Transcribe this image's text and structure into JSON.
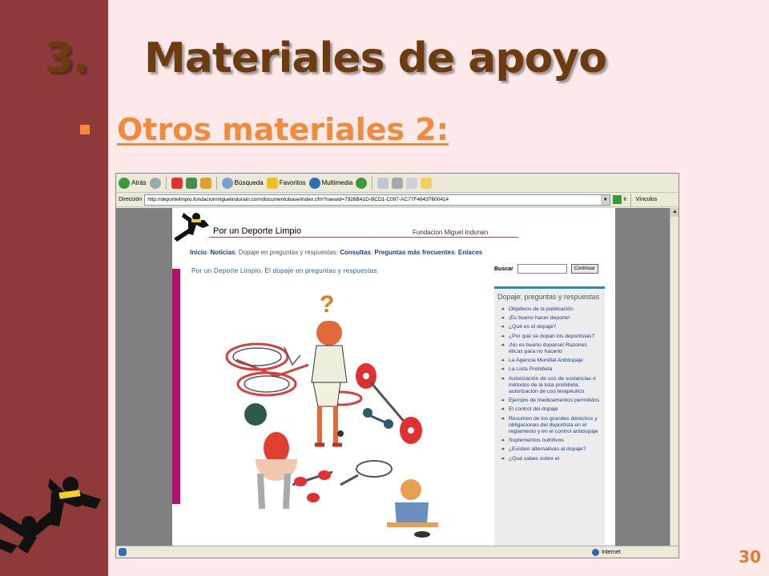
{
  "slide": {
    "number": "3.",
    "title": "Materiales de apoyo",
    "bullet": "Otros materiales  2:",
    "page_number": "30"
  },
  "colors": {
    "left_bar": "#8f3a3a",
    "background": "#fde9e9",
    "title": "#6b3c12",
    "accent": "#f08a3c",
    "magenta": "#b40f6e"
  },
  "browser": {
    "toolbar": {
      "back": "Atrás",
      "search": "Búsqueda",
      "favorites": "Favoritos",
      "multimedia": "Multimedia"
    },
    "address_label": "Dirección",
    "url": "http://deportelimpio.fundacionmiguelindurain.com/documentobase/index.cfm?navuid=7926B41D-BCD1-C097-AC77F46437600414",
    "go_label": "Ir",
    "links_label": "Vínculos",
    "status_zone": "Internet"
  },
  "webpage": {
    "site_title": "Por un Deporte Limpio",
    "foundation": "Fundacion Miguel Indurain",
    "nav": {
      "inicio": "Inicio",
      "noticias": "Noticias",
      "current": "Dopaje en preguntas y respuestas",
      "consultas": "Consultas",
      "frecuentes": "Preguntas más frecuentes",
      "enlaces": "Enlaces"
    },
    "heading": "Por un Deporte Limpio. El dopaje en preguntas y respuestas.",
    "search_label": "Buscar",
    "search_button": "Continuar",
    "question_mark": "?",
    "sidebar": {
      "title": "Dopaje: preguntas y respuestas",
      "items": [
        "Objetivos de la publicación",
        "¡Es bueno hacer deporte!",
        "¿Qué es el dopaje?",
        "¿Por qué se dopan los deportistas?",
        "¡No es bueno doparse! Razones éticas para no hacerlo",
        "La Agencia Mundial Antidopaje",
        "La Lista Prohibida",
        "Autorización de uso de sustancias o métodos de la lista prohibida: autorización de uso terapéutico",
        "Ejemplo de medicamentos permitidos",
        "El control del dopaje",
        "Resumen de los grandes derechos y obligaciones del deportista en el reglamento y en el control antidopaje",
        "Suplementos nutritivos",
        "¿Existen alternativas al dopaje?",
        "¿Qué sabes sobre el"
      ]
    }
  }
}
